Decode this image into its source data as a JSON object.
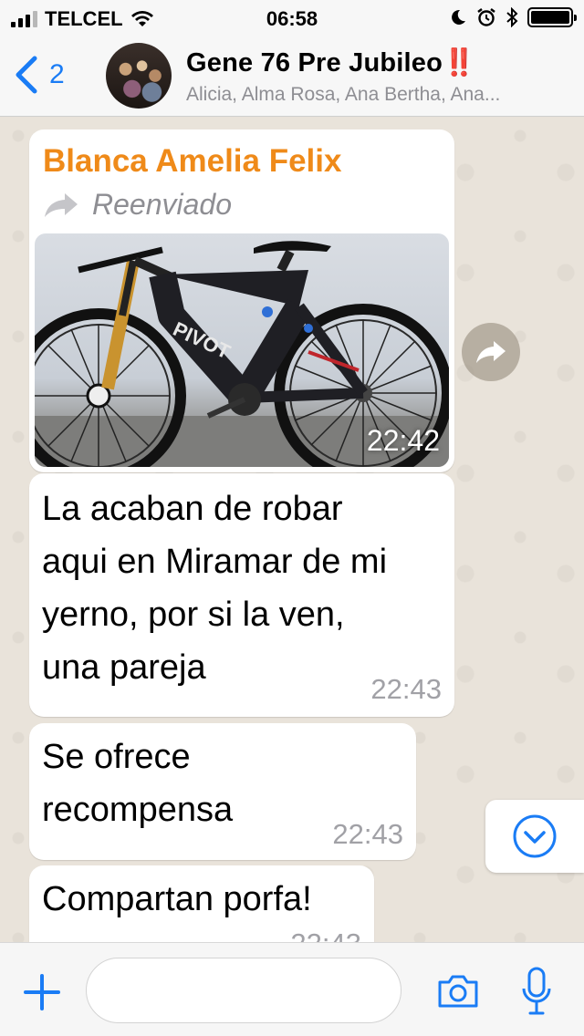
{
  "status_bar": {
    "carrier": "TELCEL",
    "time": "06:58"
  },
  "header": {
    "back_count": "2",
    "title": "Gene 76 Pre Jubileo",
    "title_suffix": "‼️",
    "members": "Alicia, Alma Rosa, Ana Bertha, Ana..."
  },
  "messages": [
    {
      "sender": "Blanca Amelia Felix",
      "forwarded_label": "Reenviado",
      "image_time": "22:42",
      "image_brand": "PIVOT"
    },
    {
      "lines": [
        "La acaban de robar",
        "aqui en Miramar de mi",
        "yerno, por si la ven,",
        "una pareja"
      ],
      "time": "22:43"
    },
    {
      "lines": [
        "Se ofrece",
        "recompensa"
      ],
      "time": "22:43"
    },
    {
      "lines": [
        "Compartan porfa!"
      ],
      "time": "22:43"
    }
  ],
  "input": {
    "placeholder": ""
  },
  "colors": {
    "accent": "#1a7cf5",
    "sender": "#ef8a19",
    "chat_background": "#e9e3da"
  },
  "icons": {
    "back": "chevron-left-icon",
    "forward": "forward-arrow-icon",
    "scroll_down": "chevron-down-circle-icon",
    "attach": "plus-icon",
    "camera": "camera-icon",
    "mic": "microphone-icon"
  }
}
